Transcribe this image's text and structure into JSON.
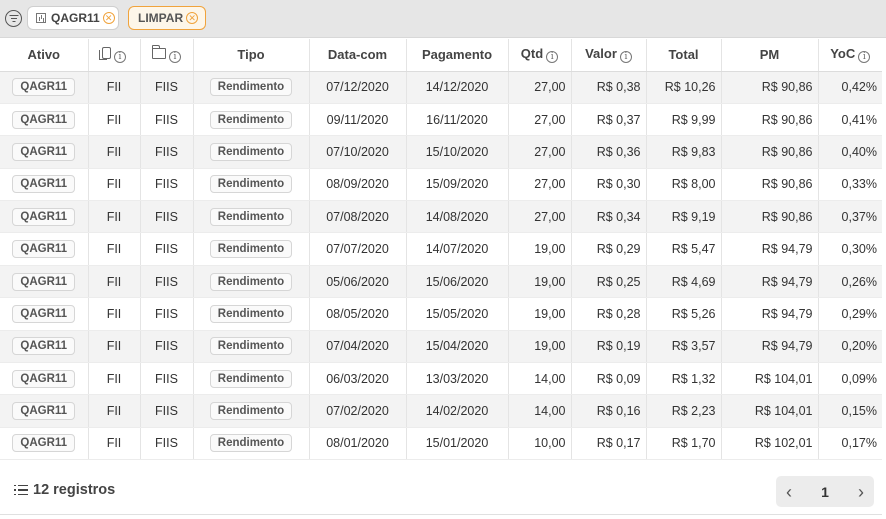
{
  "filters": {
    "asset_chip": "QAGR11",
    "clear_chip": "LIMPAR"
  },
  "table": {
    "headers": {
      "ativo": "Ativo",
      "tipo": "Tipo",
      "data_com": "Data-com",
      "pagamento": "Pagamento",
      "qtd": "Qtd",
      "valor": "Valor",
      "total": "Total",
      "pm": "PM",
      "yoc": "YoC"
    },
    "rows": [
      {
        "ativo": "QAGR11",
        "classe": "FII",
        "categoria": "FIIS",
        "tipo": "Rendimento",
        "data_com": "07/12/2020",
        "pagamento": "14/12/2020",
        "qtd": "27,00",
        "valor": "R$ 0,38",
        "total": "R$ 10,26",
        "pm": "R$ 90,86",
        "yoc": "0,42%"
      },
      {
        "ativo": "QAGR11",
        "classe": "FII",
        "categoria": "FIIS",
        "tipo": "Rendimento",
        "data_com": "09/11/2020",
        "pagamento": "16/11/2020",
        "qtd": "27,00",
        "valor": "R$ 0,37",
        "total": "R$ 9,99",
        "pm": "R$ 90,86",
        "yoc": "0,41%"
      },
      {
        "ativo": "QAGR11",
        "classe": "FII",
        "categoria": "FIIS",
        "tipo": "Rendimento",
        "data_com": "07/10/2020",
        "pagamento": "15/10/2020",
        "qtd": "27,00",
        "valor": "R$ 0,36",
        "total": "R$ 9,83",
        "pm": "R$ 90,86",
        "yoc": "0,40%"
      },
      {
        "ativo": "QAGR11",
        "classe": "FII",
        "categoria": "FIIS",
        "tipo": "Rendimento",
        "data_com": "08/09/2020",
        "pagamento": "15/09/2020",
        "qtd": "27,00",
        "valor": "R$ 0,30",
        "total": "R$ 8,00",
        "pm": "R$ 90,86",
        "yoc": "0,33%"
      },
      {
        "ativo": "QAGR11",
        "classe": "FII",
        "categoria": "FIIS",
        "tipo": "Rendimento",
        "data_com": "07/08/2020",
        "pagamento": "14/08/2020",
        "qtd": "27,00",
        "valor": "R$ 0,34",
        "total": "R$ 9,19",
        "pm": "R$ 90,86",
        "yoc": "0,37%"
      },
      {
        "ativo": "QAGR11",
        "classe": "FII",
        "categoria": "FIIS",
        "tipo": "Rendimento",
        "data_com": "07/07/2020",
        "pagamento": "14/07/2020",
        "qtd": "19,00",
        "valor": "R$ 0,29",
        "total": "R$ 5,47",
        "pm": "R$ 94,79",
        "yoc": "0,30%"
      },
      {
        "ativo": "QAGR11",
        "classe": "FII",
        "categoria": "FIIS",
        "tipo": "Rendimento",
        "data_com": "05/06/2020",
        "pagamento": "15/06/2020",
        "qtd": "19,00",
        "valor": "R$ 0,25",
        "total": "R$ 4,69",
        "pm": "R$ 94,79",
        "yoc": "0,26%"
      },
      {
        "ativo": "QAGR11",
        "classe": "FII",
        "categoria": "FIIS",
        "tipo": "Rendimento",
        "data_com": "08/05/2020",
        "pagamento": "15/05/2020",
        "qtd": "19,00",
        "valor": "R$ 0,28",
        "total": "R$ 5,26",
        "pm": "R$ 94,79",
        "yoc": "0,29%"
      },
      {
        "ativo": "QAGR11",
        "classe": "FII",
        "categoria": "FIIS",
        "tipo": "Rendimento",
        "data_com": "07/04/2020",
        "pagamento": "15/04/2020",
        "qtd": "19,00",
        "valor": "R$ 0,19",
        "total": "R$ 3,57",
        "pm": "R$ 94,79",
        "yoc": "0,20%"
      },
      {
        "ativo": "QAGR11",
        "classe": "FII",
        "categoria": "FIIS",
        "tipo": "Rendimento",
        "data_com": "06/03/2020",
        "pagamento": "13/03/2020",
        "qtd": "14,00",
        "valor": "R$ 0,09",
        "total": "R$ 1,32",
        "pm": "R$ 104,01",
        "yoc": "0,09%"
      },
      {
        "ativo": "QAGR11",
        "classe": "FII",
        "categoria": "FIIS",
        "tipo": "Rendimento",
        "data_com": "07/02/2020",
        "pagamento": "14/02/2020",
        "qtd": "14,00",
        "valor": "R$ 0,16",
        "total": "R$ 2,23",
        "pm": "R$ 104,01",
        "yoc": "0,15%"
      },
      {
        "ativo": "QAGR11",
        "classe": "FII",
        "categoria": "FIIS",
        "tipo": "Rendimento",
        "data_com": "08/01/2020",
        "pagamento": "15/01/2020",
        "qtd": "10,00",
        "valor": "R$ 0,17",
        "total": "R$ 1,70",
        "pm": "R$ 102,01",
        "yoc": "0,17%"
      }
    ]
  },
  "footer": {
    "records": "12 registros",
    "current_page": "1"
  }
}
